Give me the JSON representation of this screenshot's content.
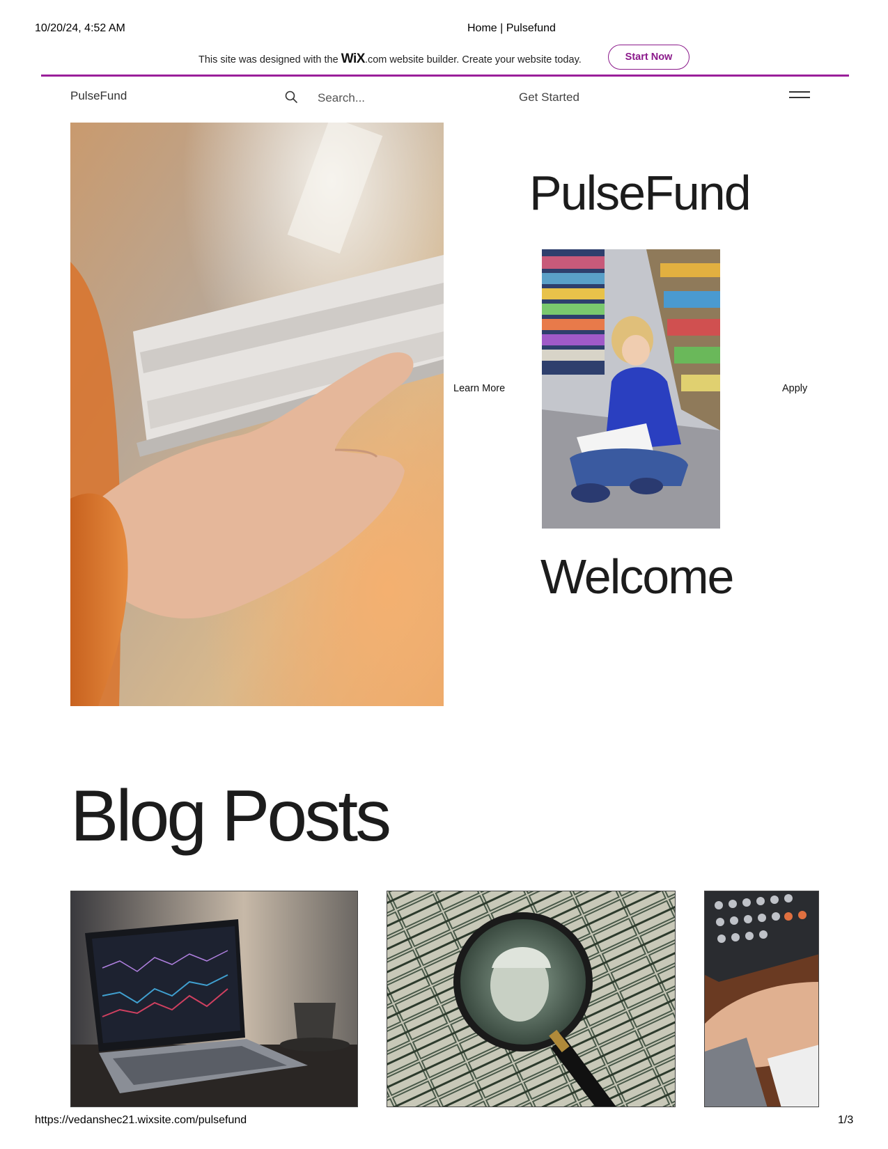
{
  "print_header": {
    "datetime": "10/20/24, 4:52 AM",
    "page_title": "Home | Pulsefund"
  },
  "wix_banner": {
    "text_before": "This site was designed with the ",
    "logo": "WiX",
    "text_after": ".com website builder. Create your website today.",
    "button_label": "Start Now",
    "accent_color": "#9a1f9a"
  },
  "nav": {
    "logo": "PulseFund",
    "search_placeholder": "Search...",
    "get_started": "Get Started"
  },
  "hero": {
    "title": "PulseFund",
    "learn_more": "Learn More",
    "apply": "Apply",
    "welcome": "Welcome"
  },
  "blog": {
    "title": "Blog Posts"
  },
  "print_footer": {
    "url": "https://vedanshec21.wixsite.com/pulsefund",
    "page": "1/3"
  }
}
